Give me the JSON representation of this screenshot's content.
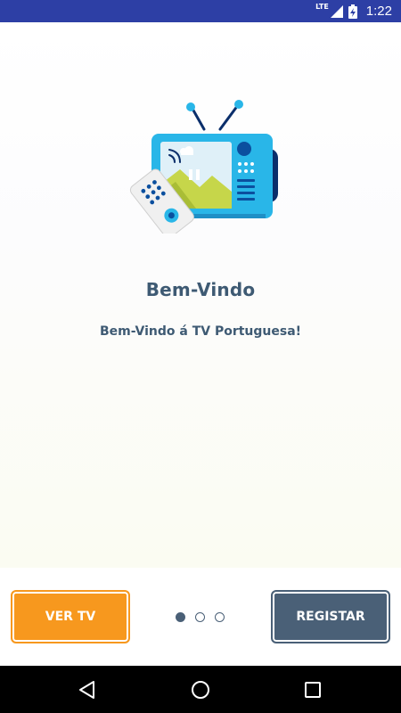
{
  "status_bar": {
    "network": "LTE",
    "time": "1:22"
  },
  "welcome": {
    "title": "Bem-Vindo",
    "subtitle": "Bem-Vindo á TV Portuguesa!"
  },
  "actions": {
    "ver_tv_label": "VER TV",
    "registar_label": "REGISTAR"
  },
  "pager": {
    "count": 3,
    "active_index": 0
  },
  "colors": {
    "status_bar": "#2d3fa5",
    "primary_text": "#3e5a73",
    "accent_orange": "#f7981e",
    "button_slate": "#4a6077",
    "tv_body": "#29b6e8"
  },
  "icons": {
    "tv": "tv-illustration-icon",
    "nav_back": "back-icon",
    "nav_home": "home-icon",
    "nav_recents": "recents-icon"
  }
}
